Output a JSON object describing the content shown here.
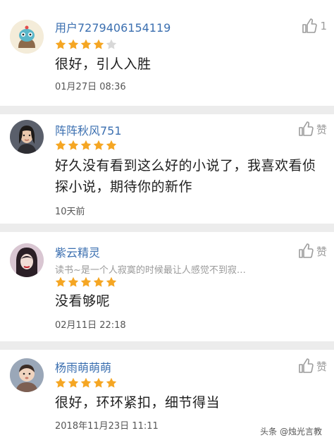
{
  "reviews": [
    {
      "username": "用户7279406154119",
      "rating": 4,
      "content": "很好，引人入胜",
      "time": "01月27日 08:36",
      "like_label": "1",
      "avatar_icon": "cartoon-avatar-icon"
    },
    {
      "username": "阵阵秋风751",
      "rating": 5,
      "content": "好久没有看到这么好的小说了，我喜欢看侦探小说，期待你的新作",
      "time": "10天前",
      "like_label": "赞",
      "avatar_icon": "user-photo-avatar-icon"
    },
    {
      "username": "紫云精灵",
      "signature": "读书~是一个人寂寞的时候最让人感觉不到寂…",
      "rating": 5,
      "content": "没看够呢",
      "time": "02月11日 22:18",
      "like_label": "赞",
      "avatar_icon": "user-photo-avatar-icon"
    },
    {
      "username": "杨雨萌萌萌",
      "rating": 5,
      "content": "很好，环环紧扣，细节得当",
      "time": "2018年11月23日 11:11",
      "like_label": "赞",
      "avatar_icon": "child-photo-avatar-icon"
    }
  ],
  "watermark": "头条 @烛光言教",
  "colors": {
    "star": "#f5a623",
    "star_empty": "#d8d8d8",
    "username": "#3b6fb0"
  }
}
